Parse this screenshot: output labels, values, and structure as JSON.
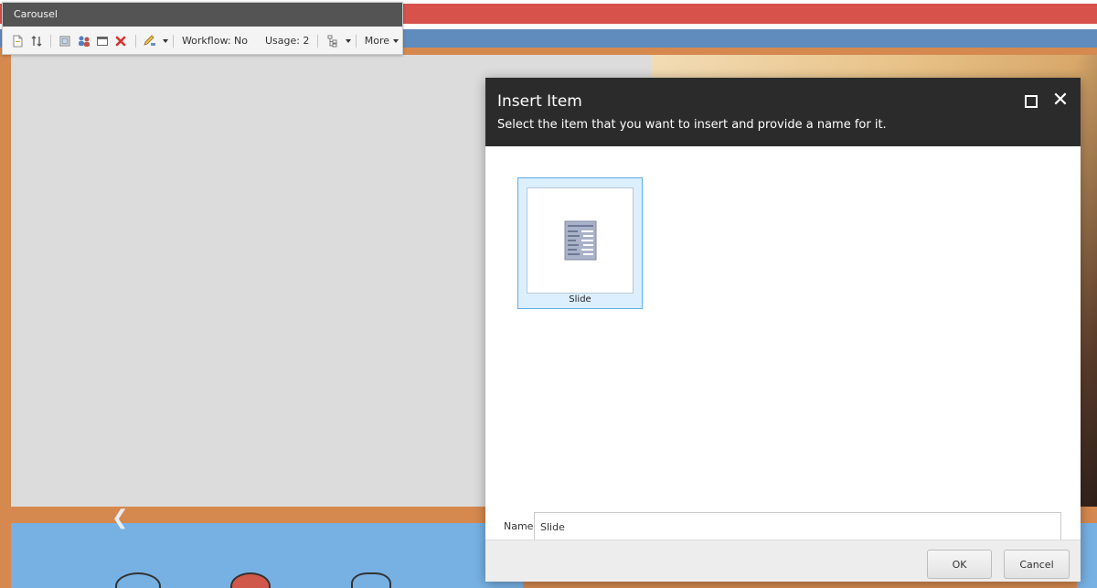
{
  "chrome": {
    "title": "Carousel",
    "workflow": "Workflow: No",
    "usage": "Usage: 2",
    "more": "More"
  },
  "dialog": {
    "title": "Insert Item",
    "subtitle": "Select the item that you want to insert and provide a name for it.",
    "items": [
      {
        "label": "Slide",
        "selected": true
      }
    ],
    "name_label": "Name:",
    "name_value": "Slide",
    "ok_label": "OK",
    "cancel_label": "Cancel"
  },
  "colors": {
    "dialog_header": "#2b2b2b",
    "tile_selected_bg": "#dcefff",
    "tile_selected_border": "#5eaee8",
    "stripe_red": "#d6524a",
    "stripe_blue": "#5f8bbd",
    "page_orange": "#d5894f"
  }
}
